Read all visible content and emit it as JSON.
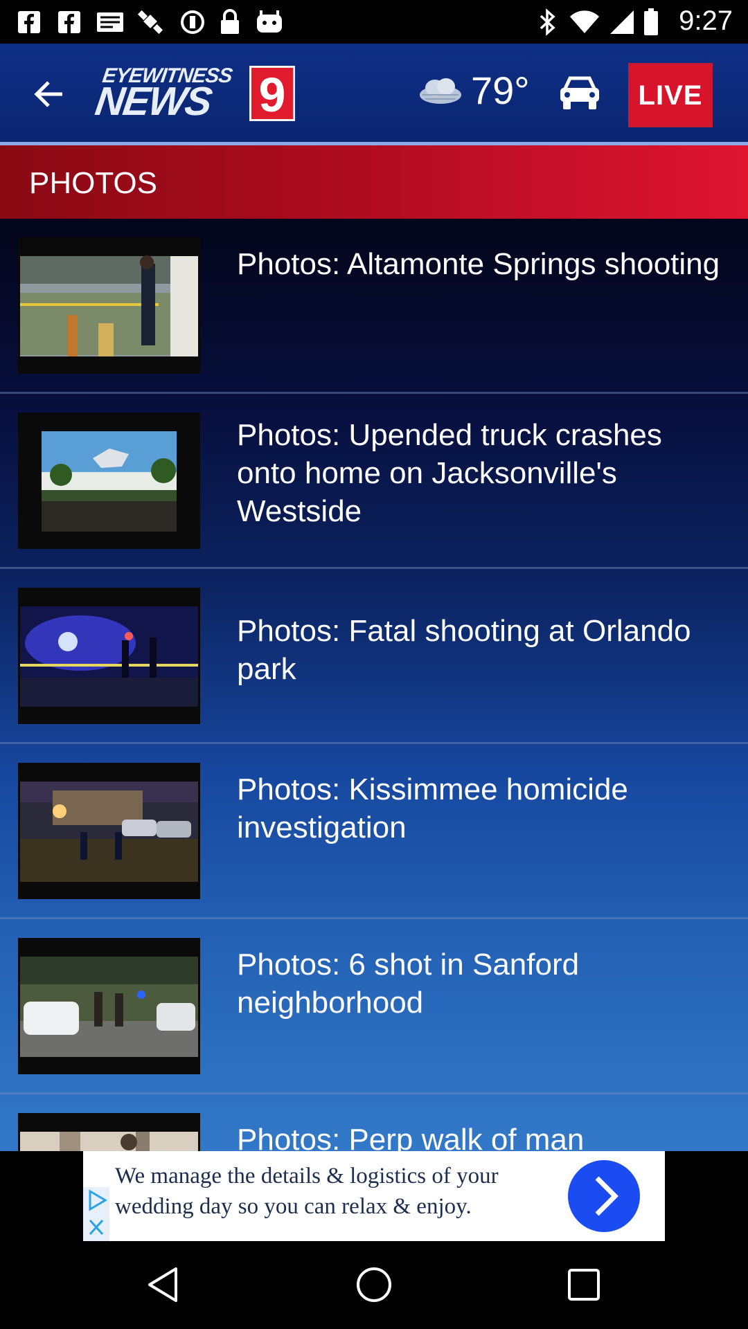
{
  "status_bar": {
    "time": "9:27",
    "left_icons": [
      "facebook-icon",
      "facebook-icon",
      "message-icon",
      "satellite-icon",
      "do-not-disturb-icon",
      "lock-icon",
      "android-icon"
    ],
    "right_icons": [
      "bluetooth-icon",
      "wifi-icon",
      "signal-icon",
      "battery-icon"
    ]
  },
  "header": {
    "logo_top": "EYEWITNESS",
    "logo_news": "NEWS",
    "logo_number": "9",
    "temperature": "79°",
    "live_label": "LIVE",
    "brand_color": "#0f2f86",
    "live_color": "#d8142c"
  },
  "section": {
    "title": "PHOTOS"
  },
  "items": [
    {
      "title": "Photos: Altamonte Springs shooting"
    },
    {
      "title": "Photos: Upended truck crashes onto home on Jacksonville's Westside"
    },
    {
      "title": "Photos: Fatal shooting at Orlando park"
    },
    {
      "title": "Photos: Kissimmee homicide investigation"
    },
    {
      "title": "Photos: 6 shot in Sanford neighborhood"
    },
    {
      "title": "Photos: Perp walk of man"
    }
  ],
  "ad": {
    "text": "We manage the details & logistics of your wedding day so you can relax & enjoy.",
    "accent": "#1b4cf2"
  },
  "nav": {
    "icons": [
      "back-triangle-icon",
      "home-circle-icon",
      "recents-square-icon"
    ]
  }
}
